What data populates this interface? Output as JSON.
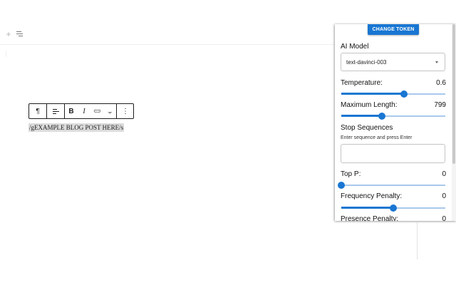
{
  "editor": {
    "post_text": "/gEXAMPLE BLOG POST HERE/s",
    "toolbar": {
      "paragraph_icon": "¶",
      "bold_label": "B",
      "italic_label": "I",
      "link_icon": "⊂⊃",
      "more_icon": "⌄",
      "options_icon": "⋮"
    }
  },
  "panel": {
    "change_token_label": "CHANGE TOKEN",
    "ai_model": {
      "label": "AI Model",
      "selected": "text-davinci-003"
    },
    "temperature": {
      "label": "Temperature:",
      "value": "0.6",
      "fraction": 0.6
    },
    "maximum_length": {
      "label": "Maximum Length:",
      "value": "799",
      "fraction": 0.39
    },
    "stop_sequences": {
      "label": "Stop Sequences",
      "helper": "Enter sequence and press Enter",
      "value": ""
    },
    "top_p": {
      "label": "Top P:",
      "value": "0",
      "fraction": 0.0
    },
    "frequency_penalty": {
      "label": "Frequency Penalty:",
      "value": "0",
      "fraction": 0.5
    },
    "presence_penalty": {
      "label": "Presence Penalty:",
      "value": "0"
    }
  },
  "colors": {
    "accent": "#1976d2",
    "rail": "#a9c9ec"
  }
}
